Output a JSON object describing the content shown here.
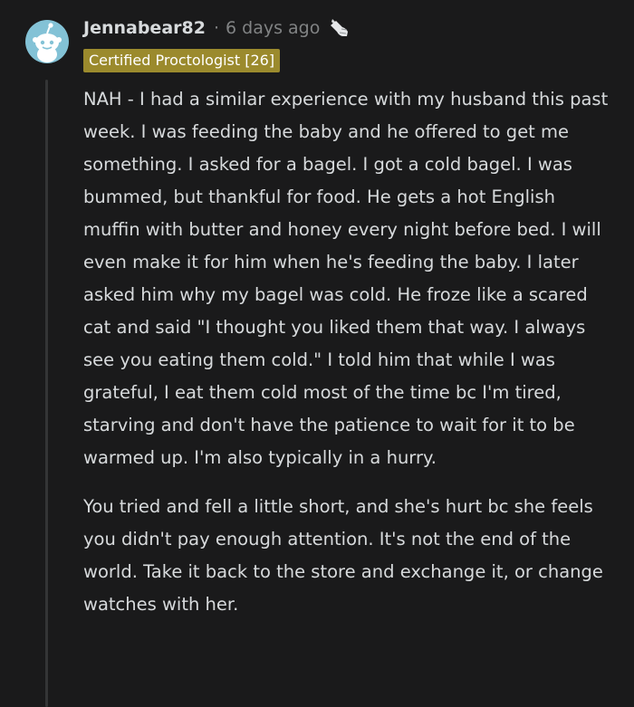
{
  "comment": {
    "username": "Jennabear82",
    "separator": "·",
    "timestamp": "6 days ago",
    "award_icon": "award-hands-icon",
    "flair": "Certified Proctologist [26]",
    "avatar_icon": "snoo-avatar-icon",
    "paragraphs": [
      "NAH - I had a similar experience with my husband this past week. I was feeding the baby and he offered to get me something. I asked for a bagel. I got a cold bagel. I was bummed, but thankful for food. He gets a hot English muffin with butter and honey every night before bed. I will even make it for him when he's feeding the baby. I later asked him why my bagel was cold. He froze like a scared cat and said \"I thought you liked them that way. I always see you eating them cold.\" I told him that while I was grateful, I eat them cold most of the time bc I'm tired, starving and don't have the patience to wait for it to be warmed up. I'm also typically in a hurry.",
      "You tried and fell a little short, and she's hurt bc she feels you didn't pay enough attention. It's not the end of the world. Take it back to the store and exchange it, or change watches with her."
    ]
  },
  "colors": {
    "background": "#1a1a1b",
    "text": "#d7dadc",
    "muted": "#818384",
    "flair_bg": "#9b8a2d",
    "avatar_bg": "#83c2d6",
    "thread_line": "#343536"
  }
}
